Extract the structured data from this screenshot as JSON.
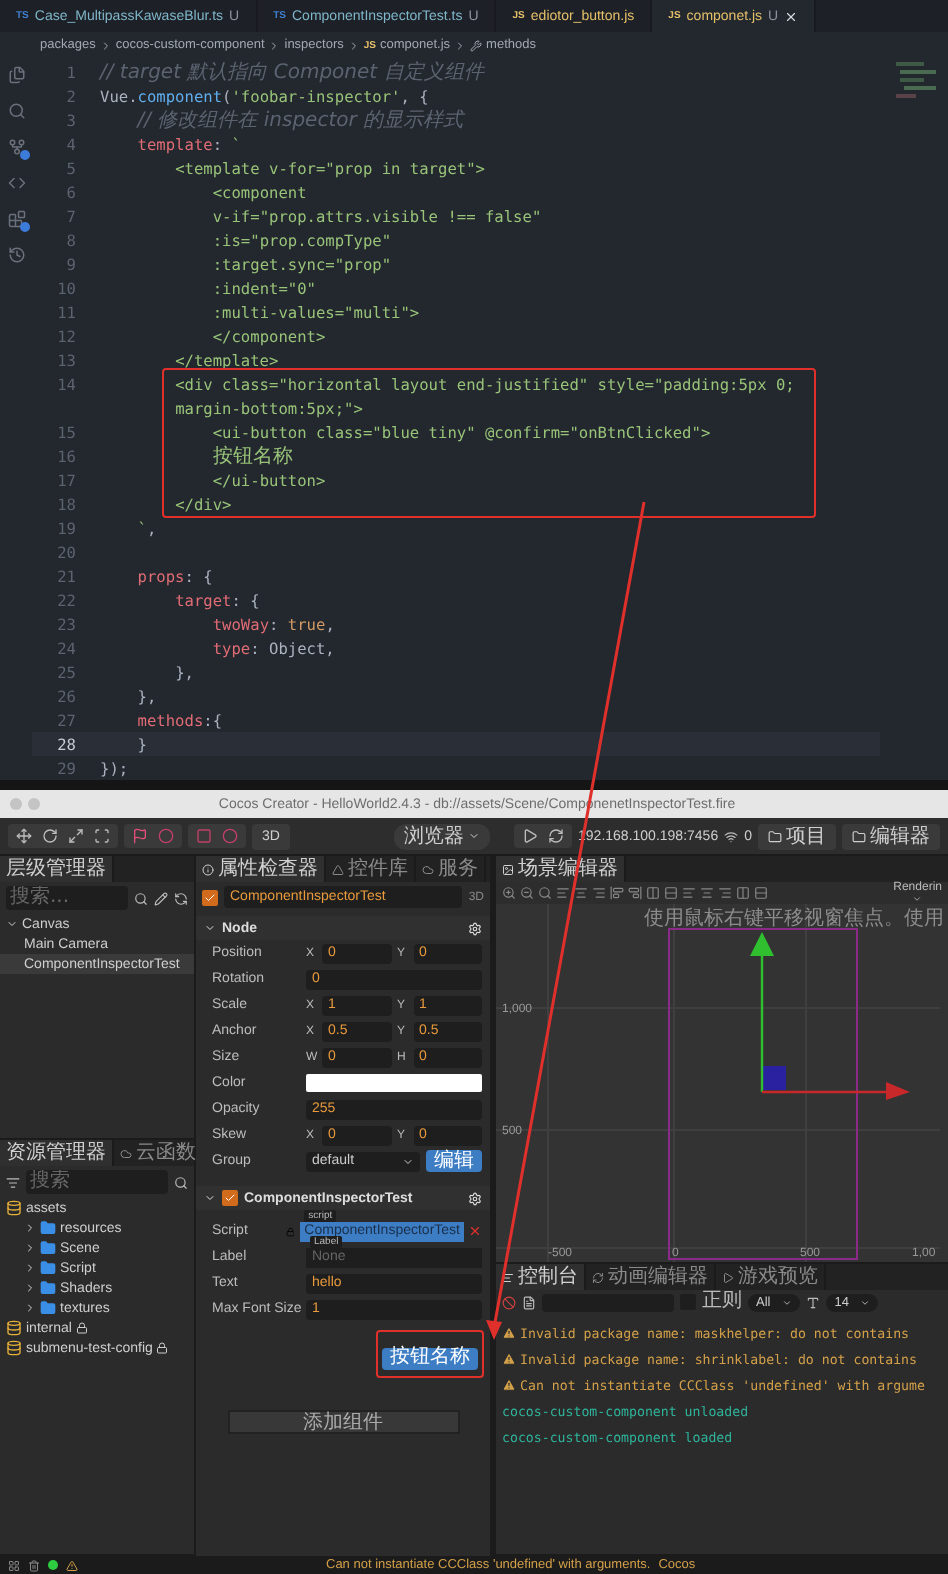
{
  "editor": {
    "tabs": [
      {
        "lang": "TS",
        "label": "Case_MultipassKawaseBlur.ts",
        "badge": "U",
        "selected": false
      },
      {
        "lang": "TS",
        "label": "ComponentInspectorTest.ts",
        "badge": "U",
        "selected": false
      },
      {
        "lang": "JS",
        "label": "ediotor_button.js",
        "selected": false
      },
      {
        "lang": "JS",
        "label": "componet.js",
        "badge": "U",
        "selected": true
      }
    ],
    "breadcrumb": [
      {
        "kind": "folder",
        "label": "packages"
      },
      {
        "kind": "folder",
        "label": "cocos-custom-component"
      },
      {
        "kind": "folder",
        "label": "inspectors"
      },
      {
        "kind": "file",
        "lang": "JS",
        "label": "componet.js"
      },
      {
        "kind": "symbol",
        "label": "methods"
      }
    ],
    "blocks": [
      {
        "boxed": false,
        "lines": [
          {
            "number": "1",
            "current": false,
            "tokens": [
              {
                "kind": "comment",
                "text": "// target 默认指向 Componet 自定义组件"
              }
            ]
          },
          {
            "number": "2",
            "current": false,
            "tokens": [
              {
                "kind": "plain",
                "text": "Vue."
              },
              {
                "kind": "fn",
                "text": "component"
              },
              {
                "kind": "plain",
                "text": "("
              },
              {
                "kind": "string",
                "text": "'foobar-inspector'"
              },
              {
                "kind": "plain",
                "text": ", {"
              }
            ]
          },
          {
            "number": "3",
            "current": false,
            "tokens": [
              {
                "kind": "comment",
                "text": "    // 修改组件在 inspector 的显示样式"
              }
            ]
          },
          {
            "number": "4",
            "current": false,
            "tokens": [
              {
                "kind": "prop",
                "text": "    template"
              },
              {
                "kind": "plain",
                "text": ": "
              },
              {
                "kind": "string",
                "text": "`"
              }
            ]
          },
          {
            "number": "5",
            "current": false,
            "tokens": [
              {
                "kind": "string",
                "text": "        <template v-for=\"prop in target\">"
              }
            ]
          },
          {
            "number": "6",
            "current": false,
            "tokens": [
              {
                "kind": "string",
                "text": "            <component"
              }
            ]
          },
          {
            "number": "7",
            "current": false,
            "tokens": [
              {
                "kind": "string",
                "text": "            v-if=\"prop.attrs.visible !== false\""
              }
            ]
          },
          {
            "number": "8",
            "current": false,
            "tokens": [
              {
                "kind": "string",
                "text": "            :is=\"prop.compType\""
              }
            ]
          },
          {
            "number": "9",
            "current": false,
            "tokens": [
              {
                "kind": "string",
                "text": "            :target.sync=\"prop\""
              }
            ]
          },
          {
            "number": "10",
            "current": false,
            "tokens": [
              {
                "kind": "string",
                "text": "            :indent=\"0\""
              }
            ]
          },
          {
            "number": "11",
            "current": false,
            "tokens": [
              {
                "kind": "string",
                "text": "            :multi-values=\"multi\">"
              }
            ]
          },
          {
            "number": "12",
            "current": false,
            "tokens": [
              {
                "kind": "string",
                "text": "            </component>"
              }
            ]
          },
          {
            "number": "13",
            "current": false,
            "tokens": [
              {
                "kind": "string",
                "text": "        </template>"
              }
            ]
          }
        ]
      },
      {
        "boxed": true,
        "lines": [
          {
            "number": "14",
            "current": false,
            "tokens": [
              {
                "kind": "string",
                "text": "        <div class=\"horizontal layout end-justified\" style=\"padding:5px 0;"
              }
            ]
          },
          {
            "tokens": [
              {
                "kind": "string",
                "text": "        margin-bottom:5px;\">"
              }
            ]
          },
          {
            "number": "15",
            "current": false,
            "tokens": [
              {
                "kind": "string",
                "text": "            <ui-button class=\"blue tiny\" @confirm=\"onBtnClicked\">"
              }
            ]
          },
          {
            "number": "16",
            "current": false,
            "tokens": [
              {
                "kind": "label",
                "text": "            按钮名称"
              }
            ]
          },
          {
            "number": "17",
            "current": false,
            "tokens": [
              {
                "kind": "string",
                "text": "            </ui-button>"
              }
            ]
          },
          {
            "number": "18",
            "current": false,
            "tokens": [
              {
                "kind": "string",
                "text": "        </div>"
              }
            ]
          }
        ]
      },
      {
        "boxed": false,
        "lines": [
          {
            "number": "19",
            "current": false,
            "tokens": [
              {
                "kind": "string",
                "text": "    `"
              },
              {
                "kind": "plain",
                "text": ","
              }
            ]
          },
          {
            "number": "20",
            "current": false
          },
          {
            "number": "21",
            "current": false,
            "tokens": [
              {
                "kind": "prop",
                "text": "    props"
              },
              {
                "kind": "plain",
                "text": ": {"
              }
            ]
          },
          {
            "number": "22",
            "current": false,
            "tokens": [
              {
                "kind": "prop",
                "text": "        target"
              },
              {
                "kind": "plain",
                "text": ": {"
              }
            ]
          },
          {
            "number": "23",
            "current": false,
            "tokens": [
              {
                "kind": "prop",
                "text": "            twoWay"
              },
              {
                "kind": "plain",
                "text": ": "
              },
              {
                "kind": "keyword",
                "text": "true"
              },
              {
                "kind": "plain",
                "text": ","
              }
            ]
          },
          {
            "number": "24",
            "current": false,
            "tokens": [
              {
                "kind": "prop",
                "text": "            type"
              },
              {
                "kind": "plain",
                "text": ": Object,"
              }
            ]
          },
          {
            "number": "25",
            "current": false,
            "tokens": [
              {
                "kind": "plain",
                "text": "        },"
              }
            ]
          },
          {
            "number": "26",
            "current": false,
            "tokens": [
              {
                "kind": "plain",
                "text": "    },"
              }
            ]
          },
          {
            "number": "27",
            "current": false,
            "tokens": [
              {
                "kind": "prop",
                "text": "    methods"
              },
              {
                "kind": "plain",
                "text": ":{"
              }
            ]
          },
          {
            "number": "28",
            "current": true,
            "tokens": [
              {
                "kind": "plain",
                "text": "    }"
              }
            ]
          },
          {
            "number": "29",
            "current": false,
            "tokens": [
              {
                "kind": "plain",
                "text": "});"
              }
            ]
          }
        ]
      }
    ]
  },
  "creator": {
    "title": "Cocos Creator - HelloWorld2.4.3 - db://assets/Scene/ComponenetInspectorTest.fire",
    "toolbar": {
      "mode_button": "3D",
      "preview_select": "浏览器",
      "address": "192.168.100.198:7456",
      "connections": "0",
      "buttons": [
        "项目",
        "编辑器"
      ]
    },
    "hierarchy": {
      "title": "层级管理器",
      "search_placeholder": "搜索...",
      "tree": [
        {
          "label": "Canvas",
          "expanded": true,
          "selected": false,
          "children": [
            {
              "label": "Main Camera",
              "selected": false
            },
            {
              "label": "ComponentInspectorTest",
              "selected": true
            }
          ]
        }
      ]
    },
    "assets": {
      "tabs": [
        {
          "label": "资源管理器",
          "selected": true
        },
        {
          "label": "云函数",
          "selected": false
        }
      ],
      "search_placeholder": "搜索",
      "tree": [
        {
          "label": "assets",
          "kind": "db",
          "locked": false,
          "children": [
            {
              "label": "resources",
              "kind": "folder"
            },
            {
              "label": "Scene",
              "kind": "folder"
            },
            {
              "label": "Script",
              "kind": "folder"
            },
            {
              "label": "Shaders",
              "kind": "folder"
            },
            {
              "label": "textures",
              "kind": "folder"
            }
          ]
        },
        {
          "label": "internal",
          "kind": "db",
          "locked": true
        },
        {
          "label": "submenu-test-config",
          "kind": "db",
          "locked": true
        }
      ]
    },
    "inspector": {
      "tabs": [
        {
          "label": "属性检查器",
          "selected": true
        },
        {
          "label": "控件库",
          "selected": false
        },
        {
          "label": "服务",
          "selected": false
        }
      ],
      "node_name": "ComponentInspectorTest",
      "active": true,
      "mode": "3D",
      "node_section": "Node",
      "node_rows": [
        {
          "kind": "xy",
          "label": "Position",
          "fields": [
            {
              "axis": "X",
              "value": "0"
            },
            {
              "axis": "Y",
              "value": "0"
            }
          ]
        },
        {
          "kind": "single",
          "label": "Rotation",
          "value": "0"
        },
        {
          "kind": "xy",
          "label": "Scale",
          "fields": [
            {
              "axis": "X",
              "value": "1"
            },
            {
              "axis": "Y",
              "value": "1"
            }
          ]
        },
        {
          "kind": "xy",
          "label": "Anchor",
          "fields": [
            {
              "axis": "X",
              "value": "0.5"
            },
            {
              "axis": "Y",
              "value": "0.5"
            }
          ]
        },
        {
          "kind": "xy",
          "label": "Size",
          "fields": [
            {
              "axis": "W",
              "value": "0"
            },
            {
              "axis": "H",
              "value": "0"
            }
          ]
        },
        {
          "kind": "color",
          "label": "Color",
          "color": "#ffffff"
        },
        {
          "kind": "single",
          "label": "Opacity",
          "value": "255"
        },
        {
          "kind": "xy",
          "label": "Skew",
          "fields": [
            {
              "axis": "X",
              "value": "0"
            },
            {
              "axis": "Y",
              "value": "0"
            }
          ]
        },
        {
          "kind": "select",
          "label": "Group",
          "value": "default",
          "button": "编辑"
        }
      ],
      "component": {
        "name": "ComponentInspectorTest",
        "enabled": true,
        "rows": [
          {
            "kind": "script",
            "label": "Script",
            "tag": "script",
            "value": "ComponentInspectorTest",
            "locked": true
          },
          {
            "kind": "ref",
            "label": "Label",
            "tag": "Label",
            "placeholder": "None"
          },
          {
            "kind": "text",
            "label": "Text",
            "value": "hello"
          },
          {
            "kind": "single",
            "label": "Max Font Size",
            "value": "1"
          }
        ],
        "custom_button": "按钮名称",
        "annotated": true
      },
      "add_component": "添加组件"
    },
    "scene": {
      "tab": "场景编辑器",
      "render_select": "Renderin",
      "hint": "使用鼠标右键平移视窗焦点。使用",
      "y_labels": [
        "1,000",
        "500"
      ],
      "x_labels": [
        "-500",
        "0",
        "500",
        "1,00"
      ]
    },
    "console": {
      "tabs": [
        {
          "label": "控制台",
          "selected": true
        },
        {
          "label": "动画编辑器",
          "selected": false
        },
        {
          "label": "游戏预览",
          "selected": false
        }
      ],
      "regex_label": "正则",
      "regex": false,
      "level_select": "All",
      "font_size": "14",
      "logs": [
        {
          "kind": "warn",
          "text": "Invalid package name: maskhelper: do not contains"
        },
        {
          "kind": "warn",
          "text": "Invalid package name: shrinklabel: do not contains"
        },
        {
          "kind": "warn",
          "text": "Can not instantiate CCClass 'undefined' with argume"
        },
        {
          "kind": "info",
          "text": "cocos-custom-component unloaded"
        },
        {
          "kind": "info",
          "text": "cocos-custom-component loaded"
        }
      ]
    },
    "status": {
      "message": "Can not instantiate CCClass 'undefined' with arguments.",
      "brand": "Cocos"
    }
  }
}
